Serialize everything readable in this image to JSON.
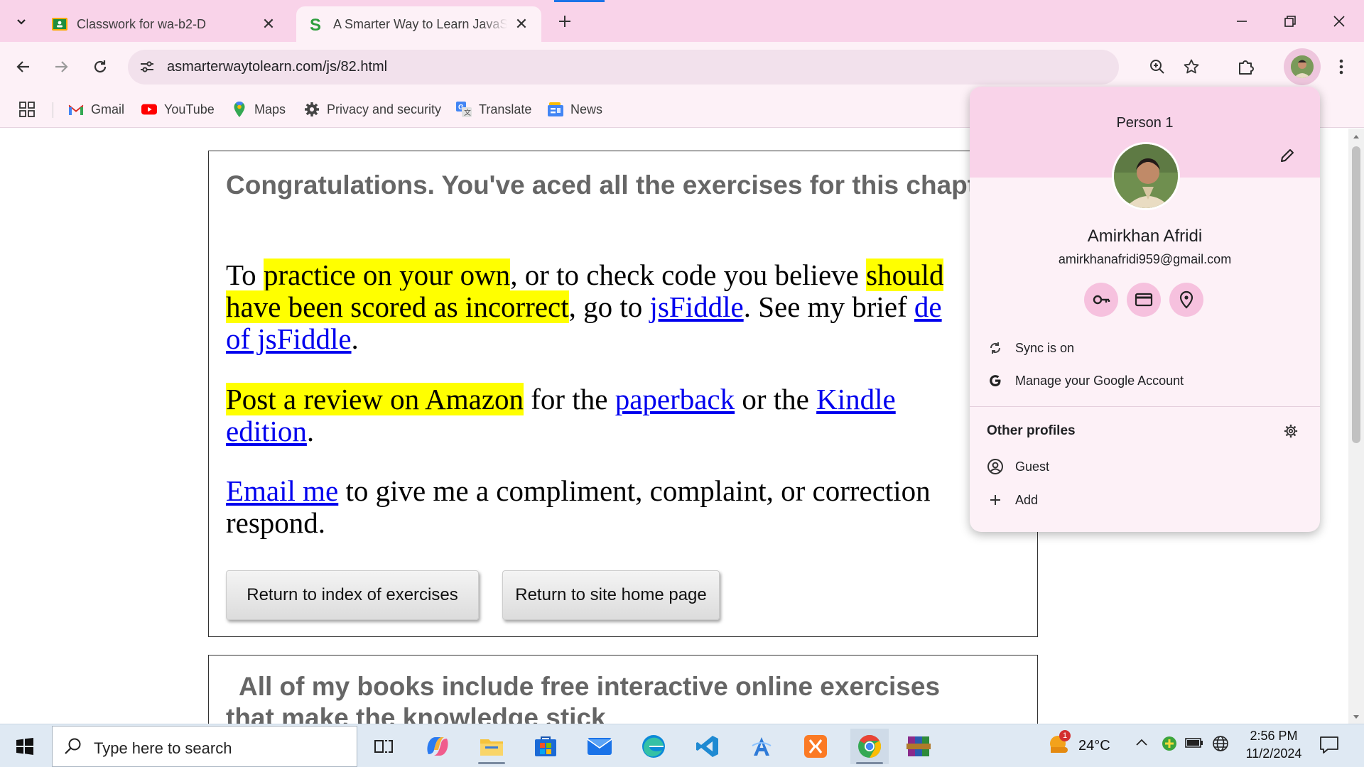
{
  "browser": {
    "tabs": [
      {
        "title": "Classwork for wa-b2-D",
        "icon": "google-classroom-icon"
      },
      {
        "title": "A Smarter Way to Learn JavaScript",
        "icon": "smarter-way-s-icon",
        "active": true
      }
    ],
    "url": "asmarterwaytolearn.com/js/82.html",
    "bookmarks": [
      {
        "label": "Gmail",
        "icon": "gmail-icon"
      },
      {
        "label": "YouTube",
        "icon": "youtube-icon"
      },
      {
        "label": "Maps",
        "icon": "maps-icon"
      },
      {
        "label": "Privacy and security",
        "icon": "gear-icon"
      },
      {
        "label": "Translate",
        "icon": "translate-icon"
      },
      {
        "label": "News",
        "icon": "news-icon"
      }
    ]
  },
  "page": {
    "congrats": "Congratulations. You've aced all the exercises for this chapter.",
    "p1": {
      "a": "To ",
      "hl1": "practice on your own",
      "b": ", or to check code you believe ",
      "hl2a": "should",
      "hl2b": "have been scored as incorrect",
      "c": ", go to ",
      "link1": "jsFiddle",
      "d": ". See my brief ",
      "link2a": "de",
      "link2b": "of jsFiddle",
      "e": "."
    },
    "p2": {
      "hl": "Post a review on Amazon",
      "a": " for the ",
      "link1": "paperback",
      "b": " or the ",
      "link2a": "Kindle",
      "link2b": "edition",
      "c": "."
    },
    "p3": {
      "link": "Email me",
      "a": " to give me a compliment, complaint, or correction",
      "b": "respond."
    },
    "buttons": {
      "index": "Return to index of exercises",
      "home": "Return to site home page"
    },
    "books_line1": "All of my books include free interactive online exercises",
    "books_line2": "that make the knowledge stick"
  },
  "profile": {
    "title": "Person 1",
    "name": "Amirkhan Afridi",
    "email": "amirkhanafridi959@gmail.com",
    "sync": "Sync is on",
    "manage": "Manage your Google Account",
    "other_profiles": "Other profiles",
    "guest": "Guest",
    "add": "Add"
  },
  "taskbar": {
    "search_placeholder": "Type here to search",
    "weather_temp": "24°C",
    "weather_badge": "1",
    "time": "2:56 PM",
    "date": "11/2/2024"
  }
}
